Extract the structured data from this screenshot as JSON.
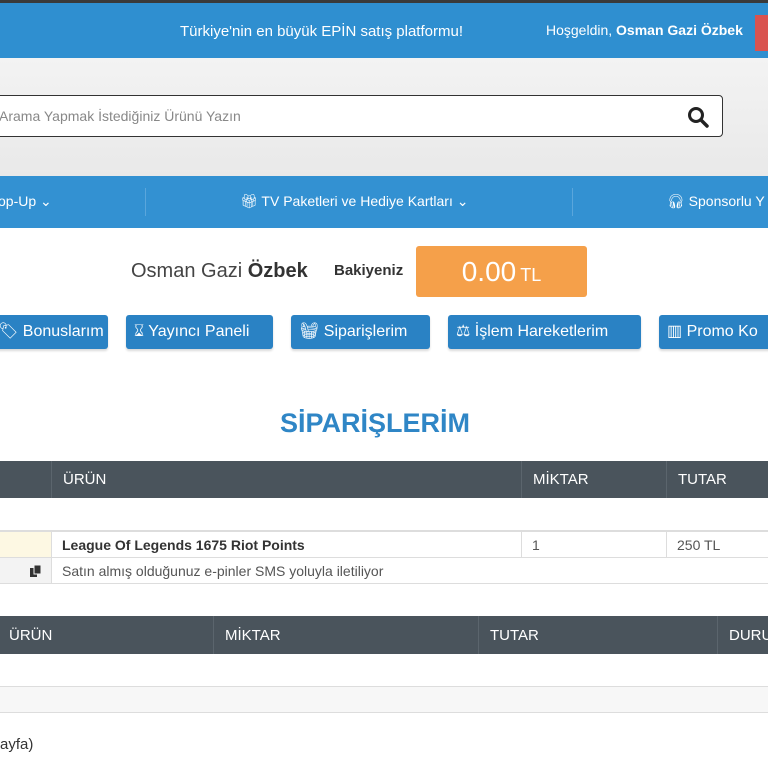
{
  "topbar": {
    "slogan": "Türkiye'nin en büyük EPİN satış platformu!",
    "welcome_prefix": "Hoşgeldin,",
    "welcome_name": "Osman Gazi Özbek"
  },
  "search": {
    "placeholder": "Arama Yapmak İstediğiniz Ürünü Yazın",
    "icon": "search-icon"
  },
  "nav": {
    "items": [
      {
        "label": "op-Up"
      },
      {
        "label": "TV Paketleri ve Hediye Kartları",
        "icon": "gift-icon"
      },
      {
        "label": "Sponsorlu Y",
        "icon": "headphones-icon"
      }
    ]
  },
  "account": {
    "first_names": "Osman Gazi",
    "last_name": "Özbek",
    "balance_label": "Bakiyeniz",
    "balance": "0.00",
    "currency": "TL"
  },
  "buttons": [
    {
      "label": "Bonuslarım"
    },
    {
      "label": "Yayıncı Paneli"
    },
    {
      "label": "Siparişlerim"
    },
    {
      "label": "İşlem Hareketlerim"
    },
    {
      "label": "Promo Ko"
    }
  ],
  "page_title": "SİPARİŞLERİM",
  "orders_table": {
    "headers": [
      "ÜRÜN",
      "MİKTAR",
      "TUTAR"
    ],
    "rows": [
      {
        "product": "League Of Legends 1675 Riot Points",
        "quantity": "1",
        "amount": "250 TL",
        "note": "Satın almış olduğunuz e-pinler SMS yoluyla iletiliyor"
      }
    ]
  },
  "second_table": {
    "headers": [
      "ÜRÜN",
      "MİKTAR",
      "TUTAR",
      "DURU"
    ]
  },
  "pager": {
    "text": "ayfa)"
  },
  "colors": {
    "primary": "#2f8fd0",
    "button": "#2a82c4",
    "balance": "#f5a04a",
    "table_header": "#4a545c",
    "title": "#2f86c6"
  }
}
